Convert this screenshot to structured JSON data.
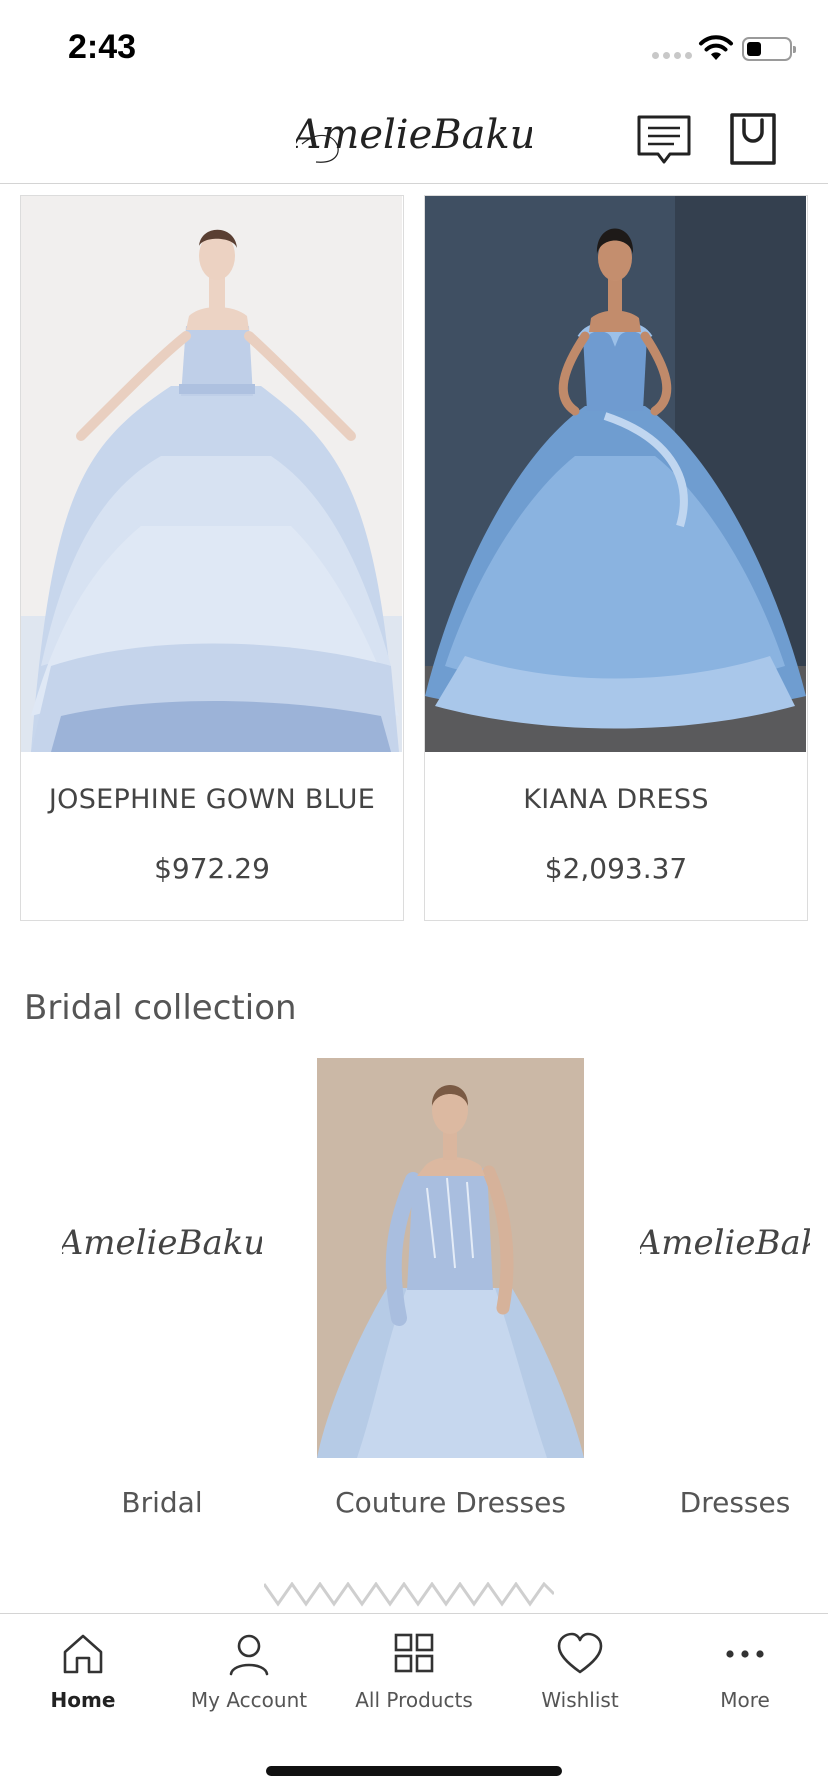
{
  "status_bar": {
    "time": "2:43"
  },
  "header": {
    "brand": "AmelieBaku"
  },
  "products": [
    {
      "name": "JOSEPHINE GOWN BLUE",
      "price": "$972.29"
    },
    {
      "name": "KIANA DRESS",
      "price": "$2,093.37"
    }
  ],
  "section": {
    "title": "Bridal collection"
  },
  "collections": [
    {
      "label": "Bridal"
    },
    {
      "label": "Couture Dresses"
    },
    {
      "label": "Dresses"
    }
  ],
  "tabbar": {
    "items": [
      {
        "label": "Home",
        "icon": "home-icon",
        "active": true
      },
      {
        "label": "My Account",
        "icon": "user-icon"
      },
      {
        "label": "All Products",
        "icon": "grid-icon"
      },
      {
        "label": "Wishlist",
        "icon": "heart-icon"
      },
      {
        "label": "More",
        "icon": "more-icon"
      }
    ]
  },
  "colors": {
    "text": "#444444",
    "border": "#dcdcdc",
    "dress_blue": "#8fb4dc"
  }
}
